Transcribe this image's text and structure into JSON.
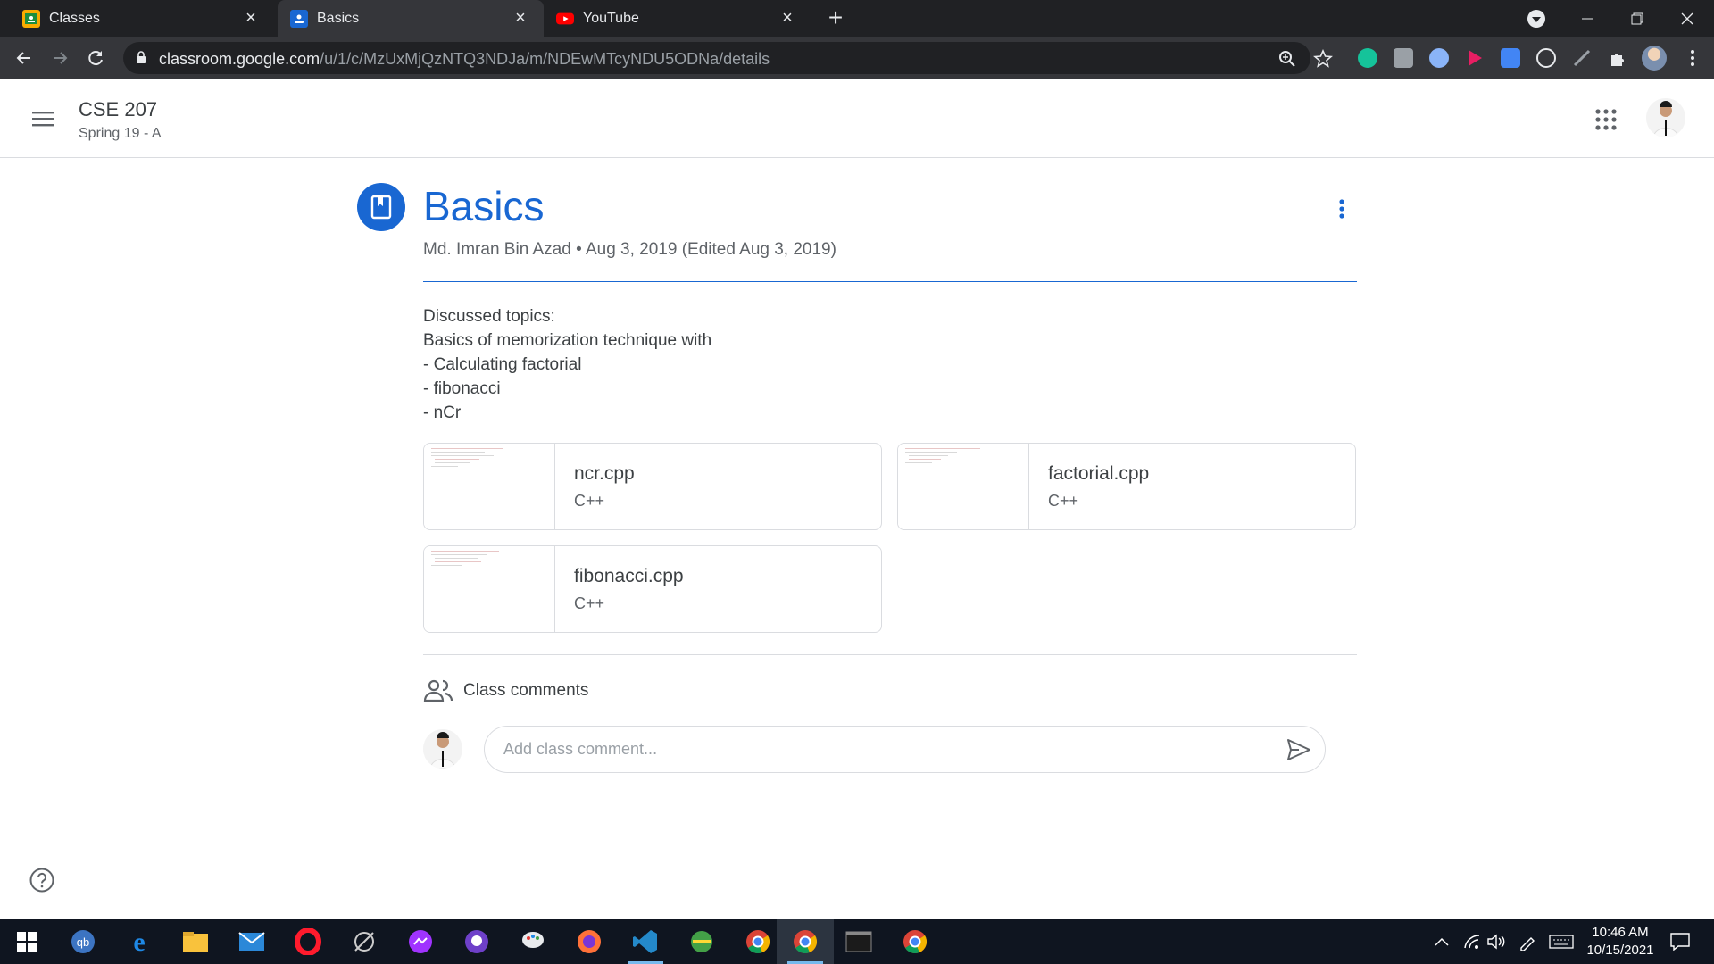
{
  "browser": {
    "tabs": [
      {
        "title": "Classes",
        "icon": "classroom-icon",
        "active": false
      },
      {
        "title": "Basics",
        "icon": "assignment-icon",
        "active": true
      },
      {
        "title": "YouTube",
        "icon": "youtube-icon",
        "active": false
      }
    ],
    "address": {
      "domain": "classroom.google.com",
      "path": "/u/1/c/MzUxMjQzNTQ3NDJa/m/NDEwMTcyNDU5ODNa/details"
    }
  },
  "classroom": {
    "class_name": "CSE 207",
    "section": "Spring 19 - A"
  },
  "post": {
    "title": "Basics",
    "meta": "Md. Imran Bin Azad • Aug 3, 2019 (Edited Aug 3, 2019)",
    "body_lines": [
      "Discussed topics:",
      "Basics of memorization technique with",
      "- Calculating factorial",
      "- fibonacci",
      "- nCr"
    ],
    "attachments": [
      {
        "name": "ncr.cpp",
        "type": "C++"
      },
      {
        "name": "factorial.cpp",
        "type": "C++"
      },
      {
        "name": "fibonacci.cpp",
        "type": "C++"
      }
    ]
  },
  "comments": {
    "label": "Class comments",
    "placeholder": "Add class comment..."
  },
  "taskbar": {
    "time": "10:46 AM",
    "date": "10/15/2021"
  },
  "colors": {
    "accent": "#1967d2",
    "tab_bg": "#202124",
    "toolbar_bg": "#35363a",
    "taskbar_bg": "#0f1520"
  }
}
